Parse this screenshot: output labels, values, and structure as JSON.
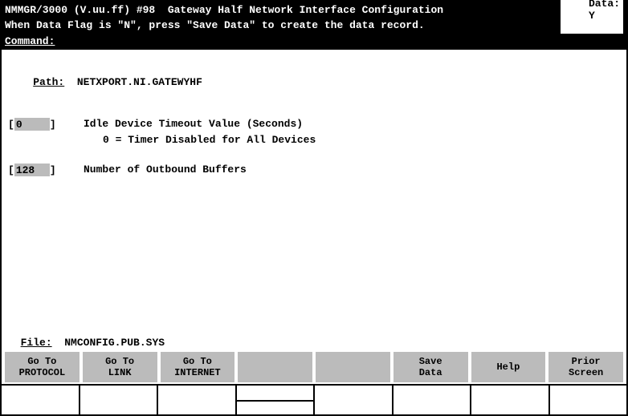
{
  "header": {
    "title": "NMMGR/3000 (V.uu.ff) #98  Gateway Half Network Interface Configuration",
    "data_label": "Data:",
    "data_value": "Y"
  },
  "hint": "When Data Flag is \"N\", press \"Save Data\" to create the data record.",
  "command": {
    "label": "Command:",
    "value": ""
  },
  "path": {
    "label": "Path:",
    "value": "NETXPORT.NI.GATEWYHF"
  },
  "fields": [
    {
      "value": "0",
      "label": "Idle Device Timeout Value (Seconds)",
      "sub": "0 = Timer Disabled for All Devices"
    },
    {
      "value": "128",
      "label": "Number of Outbound Buffers",
      "sub": ""
    }
  ],
  "file": {
    "label": "File:",
    "value": "NMCONFIG.PUB.SYS"
  },
  "fkeys": [
    {
      "line1": "Go To",
      "line2": "PROTOCOL"
    },
    {
      "line1": "Go To",
      "line2": "LINK"
    },
    {
      "line1": "Go To",
      "line2": "INTERNET"
    },
    {
      "line1": "",
      "line2": ""
    },
    {
      "line1": "",
      "line2": ""
    },
    {
      "line1": "Save",
      "line2": "Data"
    },
    {
      "line1": "Help",
      "line2": ""
    },
    {
      "line1": "Prior",
      "line2": "Screen"
    }
  ]
}
